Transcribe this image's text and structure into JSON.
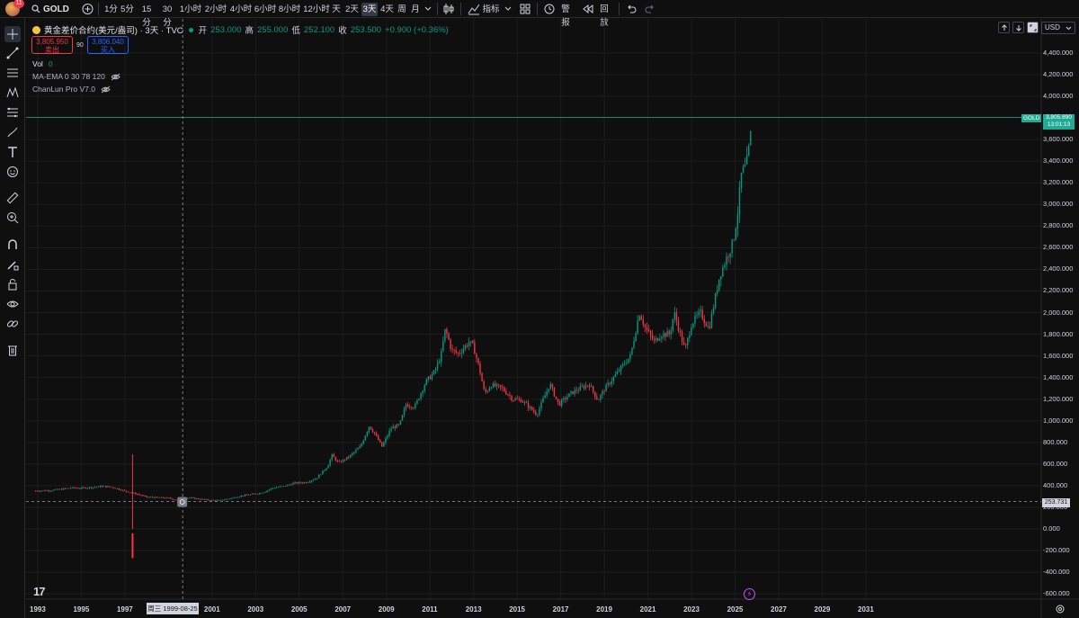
{
  "topbar": {
    "notification_count": "11",
    "symbol": "GOLD",
    "intervals": [
      "1分",
      "5分",
      "15分",
      "30分",
      "1小时",
      "2小时",
      "4小时",
      "6小时",
      "8小时",
      "12小时",
      "天",
      "2天",
      "3天",
      "4天",
      "周",
      "月"
    ],
    "active_interval": "3天",
    "indicators_label": "指标",
    "alert_label": "警报",
    "replay_label": "回放"
  },
  "header": {
    "title": "黄金差价合约(美元/盎司) · 3天 · TVC",
    "open_label": "开",
    "open_value": "253.000",
    "high_label": "高",
    "high_value": "255.000",
    "low_label": "低",
    "low_value": "252.100",
    "close_label": "收",
    "close_value": "253.500",
    "change_value": "+0.900 (+0.36%)",
    "sell_price": "3,805.950",
    "sell_label": "卖出",
    "spread": "90",
    "buy_price": "3,806.040",
    "buy_label": "买入",
    "vol_label": "Vol",
    "vol_value": "0",
    "indicator_1": "MA-EMA 0 30 78 120",
    "indicator_2": "ChanLun Pro V7.0",
    "currency": "USD"
  },
  "colors": {
    "up": "#089981",
    "down": "#f23645",
    "accent": "#22ab94",
    "background": "#0f0f0f"
  },
  "price_tags": {
    "symbol_tag": "GOLD",
    "last_price": "3,805.890",
    "countdown": "13:01:13",
    "cursor_price": "253.731",
    "cursor_date": "周三 1999-08-25"
  },
  "chart_data": {
    "type": "candlestick",
    "title": "",
    "x_axis_ticks": [
      "1993",
      "1995",
      "1997",
      "2001",
      "2003",
      "2005",
      "2007",
      "2009",
      "2011",
      "2013",
      "2015",
      "2017",
      "2019",
      "2021",
      "2023",
      "2025",
      "2027",
      "2029",
      "2031"
    ],
    "y_axis_ticks": [
      "4,400.000",
      "4,200.000",
      "4,000.000",
      "3,600.000",
      "3,400.000",
      "3,200.000",
      "3,000.000",
      "2,800.000",
      "2,600.000",
      "2,400.000",
      "2,200.000",
      "2,000.000",
      "1,800.000",
      "1,600.000",
      "1,400.000",
      "1,200.000",
      "1,000.000",
      "800.000",
      "600.000",
      "400.000",
      "200.000",
      "0.000",
      "-200.000",
      "-400.000",
      "-600.000"
    ],
    "ylim": [
      -620,
      4450
    ],
    "series": [
      {
        "name": "GOLD",
        "points": [
          [
            1992.9,
            352
          ],
          [
            1993.5,
            355
          ],
          [
            1994.0,
            365
          ],
          [
            1994.5,
            380
          ],
          [
            1995.0,
            378
          ],
          [
            1995.5,
            385
          ],
          [
            1996.0,
            395
          ],
          [
            1996.5,
            382
          ],
          [
            1997.0,
            350
          ],
          [
            1997.5,
            325
          ],
          [
            1998.0,
            295
          ],
          [
            1998.5,
            290
          ],
          [
            1999.0,
            286
          ],
          [
            1999.5,
            260
          ],
          [
            1999.8,
            290
          ],
          [
            2000.3,
            280
          ],
          [
            2000.8,
            268
          ],
          [
            2001.3,
            262
          ],
          [
            2001.8,
            280
          ],
          [
            2002.3,
            305
          ],
          [
            2002.8,
            320
          ],
          [
            2003.3,
            335
          ],
          [
            2003.8,
            380
          ],
          [
            2004.3,
            395
          ],
          [
            2004.8,
            425
          ],
          [
            2005.3,
            430
          ],
          [
            2005.8,
            470
          ],
          [
            2006.3,
            580
          ],
          [
            2006.5,
            680
          ],
          [
            2006.8,
            610
          ],
          [
            2007.3,
            670
          ],
          [
            2007.8,
            760
          ],
          [
            2008.2,
            950
          ],
          [
            2008.4,
            900
          ],
          [
            2008.8,
            760
          ],
          [
            2009.2,
            930
          ],
          [
            2009.6,
            960
          ],
          [
            2009.9,
            1150
          ],
          [
            2010.3,
            1130
          ],
          [
            2010.8,
            1360
          ],
          [
            2011.2,
            1450
          ],
          [
            2011.5,
            1600
          ],
          [
            2011.7,
            1850
          ],
          [
            2012.0,
            1650
          ],
          [
            2012.3,
            1620
          ],
          [
            2012.8,
            1730
          ],
          [
            2013.0,
            1680
          ],
          [
            2013.3,
            1450
          ],
          [
            2013.5,
            1250
          ],
          [
            2013.8,
            1330
          ],
          [
            2014.3,
            1300
          ],
          [
            2014.8,
            1200
          ],
          [
            2015.2,
            1190
          ],
          [
            2015.9,
            1060
          ],
          [
            2016.5,
            1340
          ],
          [
            2016.9,
            1150
          ],
          [
            2017.5,
            1260
          ],
          [
            2017.9,
            1300
          ],
          [
            2018.3,
            1340
          ],
          [
            2018.7,
            1190
          ],
          [
            2019.0,
            1290
          ],
          [
            2019.5,
            1420
          ],
          [
            2019.8,
            1500
          ],
          [
            2020.2,
            1600
          ],
          [
            2020.6,
            2000
          ],
          [
            2020.9,
            1850
          ],
          [
            2021.3,
            1730
          ],
          [
            2021.6,
            1800
          ],
          [
            2022.0,
            1800
          ],
          [
            2022.2,
            2000
          ],
          [
            2022.7,
            1650
          ],
          [
            2023.0,
            1900
          ],
          [
            2023.4,
            2000
          ],
          [
            2023.8,
            1850
          ],
          [
            2024.0,
            2050
          ],
          [
            2024.3,
            2350
          ],
          [
            2024.7,
            2550
          ],
          [
            2024.9,
            2650
          ],
          [
            2025.1,
            2900
          ],
          [
            2025.3,
            3300
          ],
          [
            2025.5,
            3350
          ],
          [
            2025.7,
            3600
          ],
          [
            2025.75,
            3806
          ]
        ]
      }
    ],
    "volume_spike": {
      "x": 1997.35,
      "value": 690,
      "low": -270
    },
    "last_price": 3805.89,
    "crosshair": {
      "x": 1999.65,
      "y": 253.731
    },
    "grid": true
  }
}
